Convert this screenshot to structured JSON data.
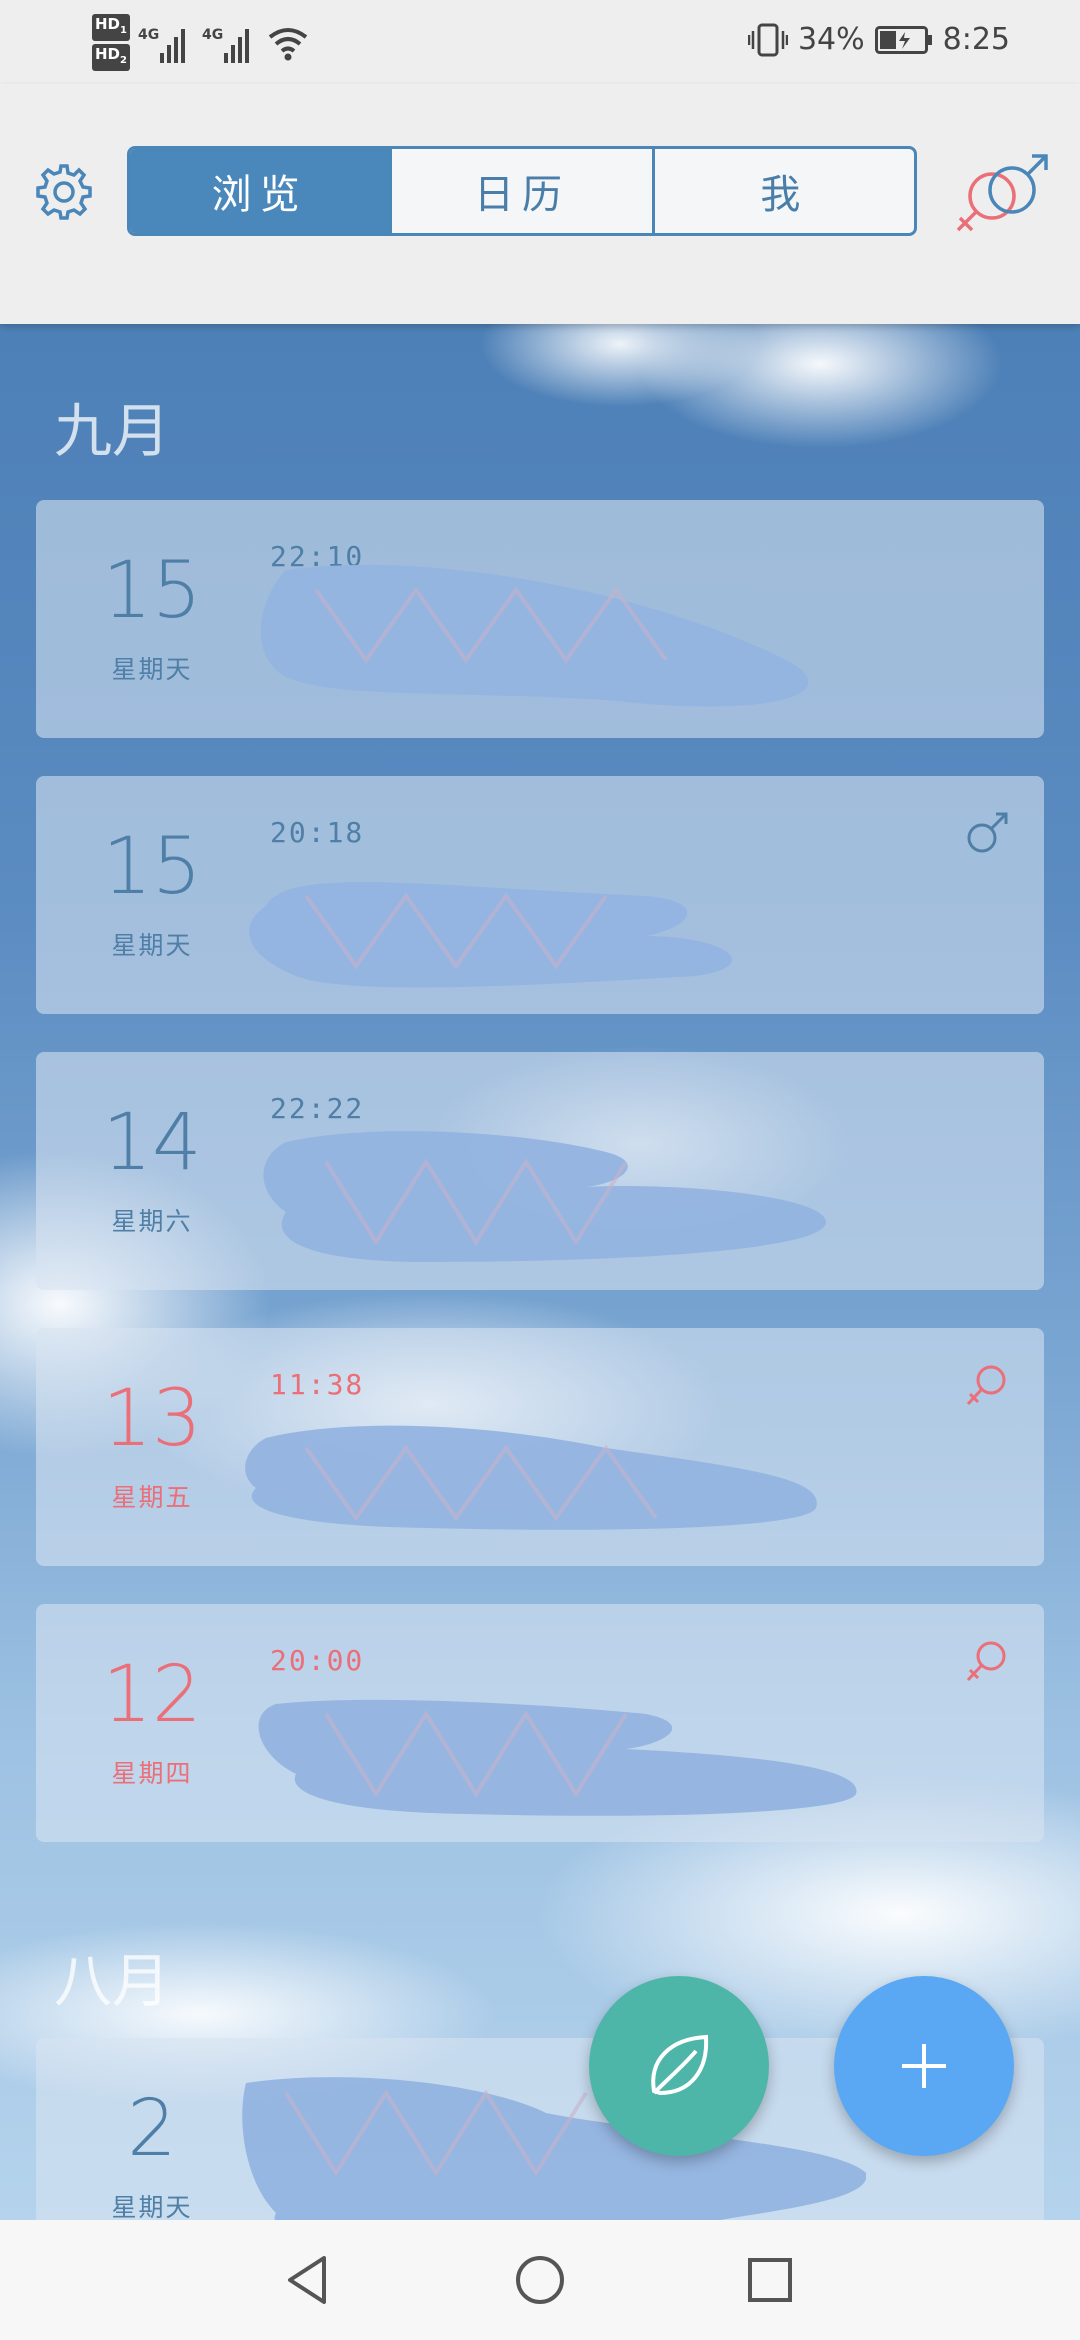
{
  "status_bar": {
    "hd1": "HD",
    "hd1_sub": "1",
    "hd2": "HD",
    "hd2_sub": "2",
    "net1": "4G",
    "net2": "4G",
    "battery": "34%",
    "time": "8:25",
    "icons": [
      "signal-icon",
      "wifi-icon",
      "vibrate-icon",
      "battery-icon"
    ]
  },
  "header": {
    "settings_icon": "gear-icon",
    "tabs": [
      {
        "label": "浏览",
        "active": true
      },
      {
        "label": "日历",
        "active": false
      },
      {
        "label": "我",
        "active": false
      }
    ],
    "gender_icon": "male-female-icon"
  },
  "months": [
    {
      "label": "九月",
      "entries": [
        {
          "day": "15",
          "weekday": "星期天",
          "time": "22:10",
          "color": "#4f7fa6",
          "gender_icon": ""
        },
        {
          "day": "15",
          "weekday": "星期天",
          "time": "20:18",
          "color": "#4f7fa6",
          "gender_icon": "male-icon"
        },
        {
          "day": "14",
          "weekday": "星期六",
          "time": "22:22",
          "color": "#4f7fa6",
          "gender_icon": ""
        },
        {
          "day": "13",
          "weekday": "星期五",
          "time": "11:38",
          "color": "#ea6f79",
          "gender_icon": "female-icon"
        },
        {
          "day": "12",
          "weekday": "星期四",
          "time": "20:00",
          "color": "#ea6f79",
          "gender_icon": "female-icon"
        }
      ]
    },
    {
      "label": "八月",
      "entries": [
        {
          "day": "2",
          "weekday": "星期天",
          "time": "",
          "color": "#4f7fa6",
          "gender_icon": ""
        }
      ]
    }
  ],
  "fab": {
    "leaf_icon": "leaf-icon",
    "add_icon": "plus-icon",
    "leaf_color": "#4db6a9",
    "add_color": "#5aa8f3"
  },
  "nav": {
    "back_icon": "back-triangle-icon",
    "home_icon": "home-circle-icon",
    "recents_icon": "recents-square-icon"
  },
  "colors": {
    "accent": "#4a88bb",
    "blue_text": "#4f7fa6",
    "pink_text": "#ea6f79",
    "redaction": "#94b4e0"
  }
}
